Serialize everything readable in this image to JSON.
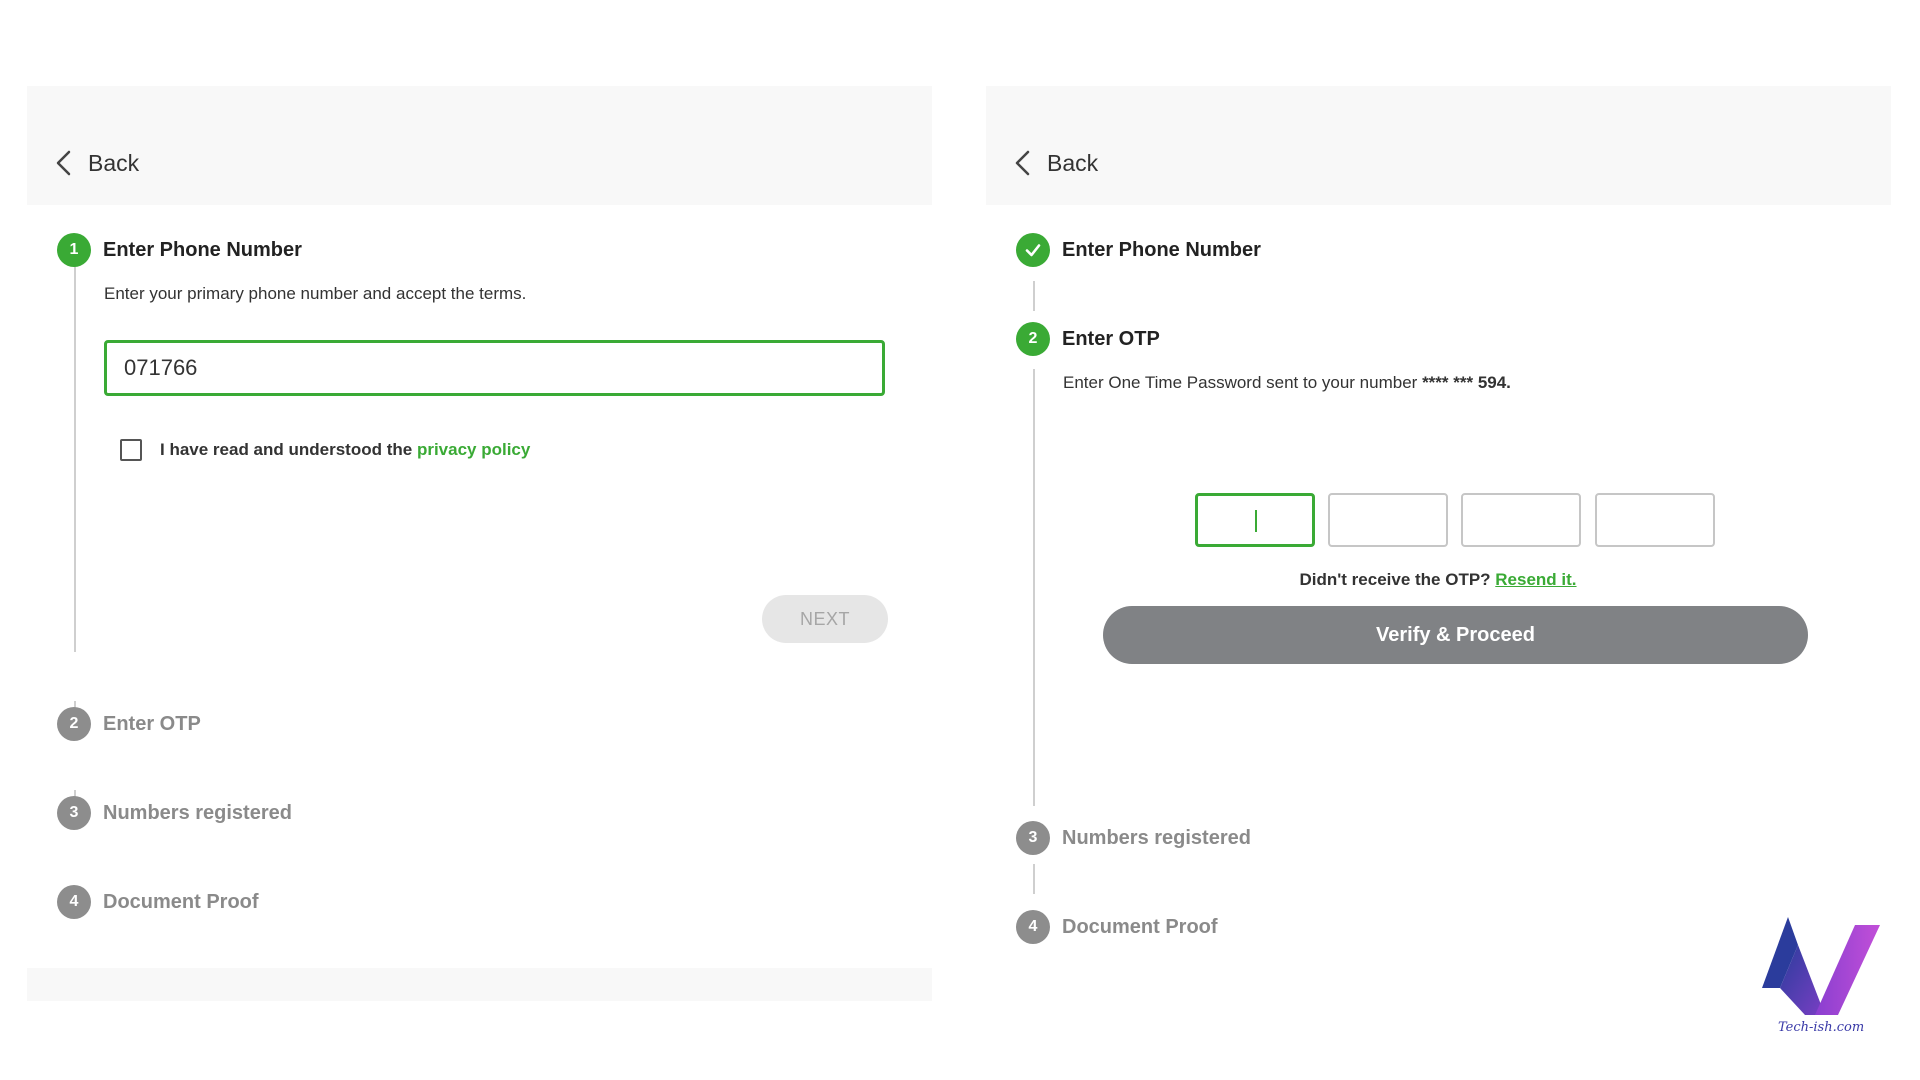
{
  "left_panel": {
    "back_label": "Back",
    "steps": [
      {
        "number": "1",
        "title": "Enter Phone Number",
        "status": "active"
      },
      {
        "number": "2",
        "title": "Enter OTP",
        "status": "inactive"
      },
      {
        "number": "3",
        "title": "Numbers registered",
        "status": "inactive"
      },
      {
        "number": "4",
        "title": "Document Proof",
        "status": "inactive"
      }
    ],
    "description": "Enter your primary phone number and accept the terms.",
    "phone_value": "071766",
    "checkbox_label": "I have read and understood the ",
    "privacy_link": "privacy policy",
    "next_label": "NEXT"
  },
  "right_panel": {
    "back_label": "Back",
    "steps": [
      {
        "number": "",
        "title": "Enter Phone Number",
        "status": "done"
      },
      {
        "number": "2",
        "title": "Enter OTP",
        "status": "active"
      },
      {
        "number": "3",
        "title": "Numbers registered",
        "status": "inactive"
      },
      {
        "number": "4",
        "title": "Document Proof",
        "status": "inactive"
      }
    ],
    "otp_description": "Enter One Time Password sent to your number ",
    "masked_number": "**** *** 594.",
    "resend_question": "Didn't receive the OTP? ",
    "resend_link": "Resend it.",
    "verify_label": "Verify & Proceed"
  },
  "watermark": {
    "text": "Tech-ish.com"
  },
  "colors": {
    "accent": "#3aaa35",
    "inactive": "#8d8d8d",
    "button_gray": "#808285"
  }
}
